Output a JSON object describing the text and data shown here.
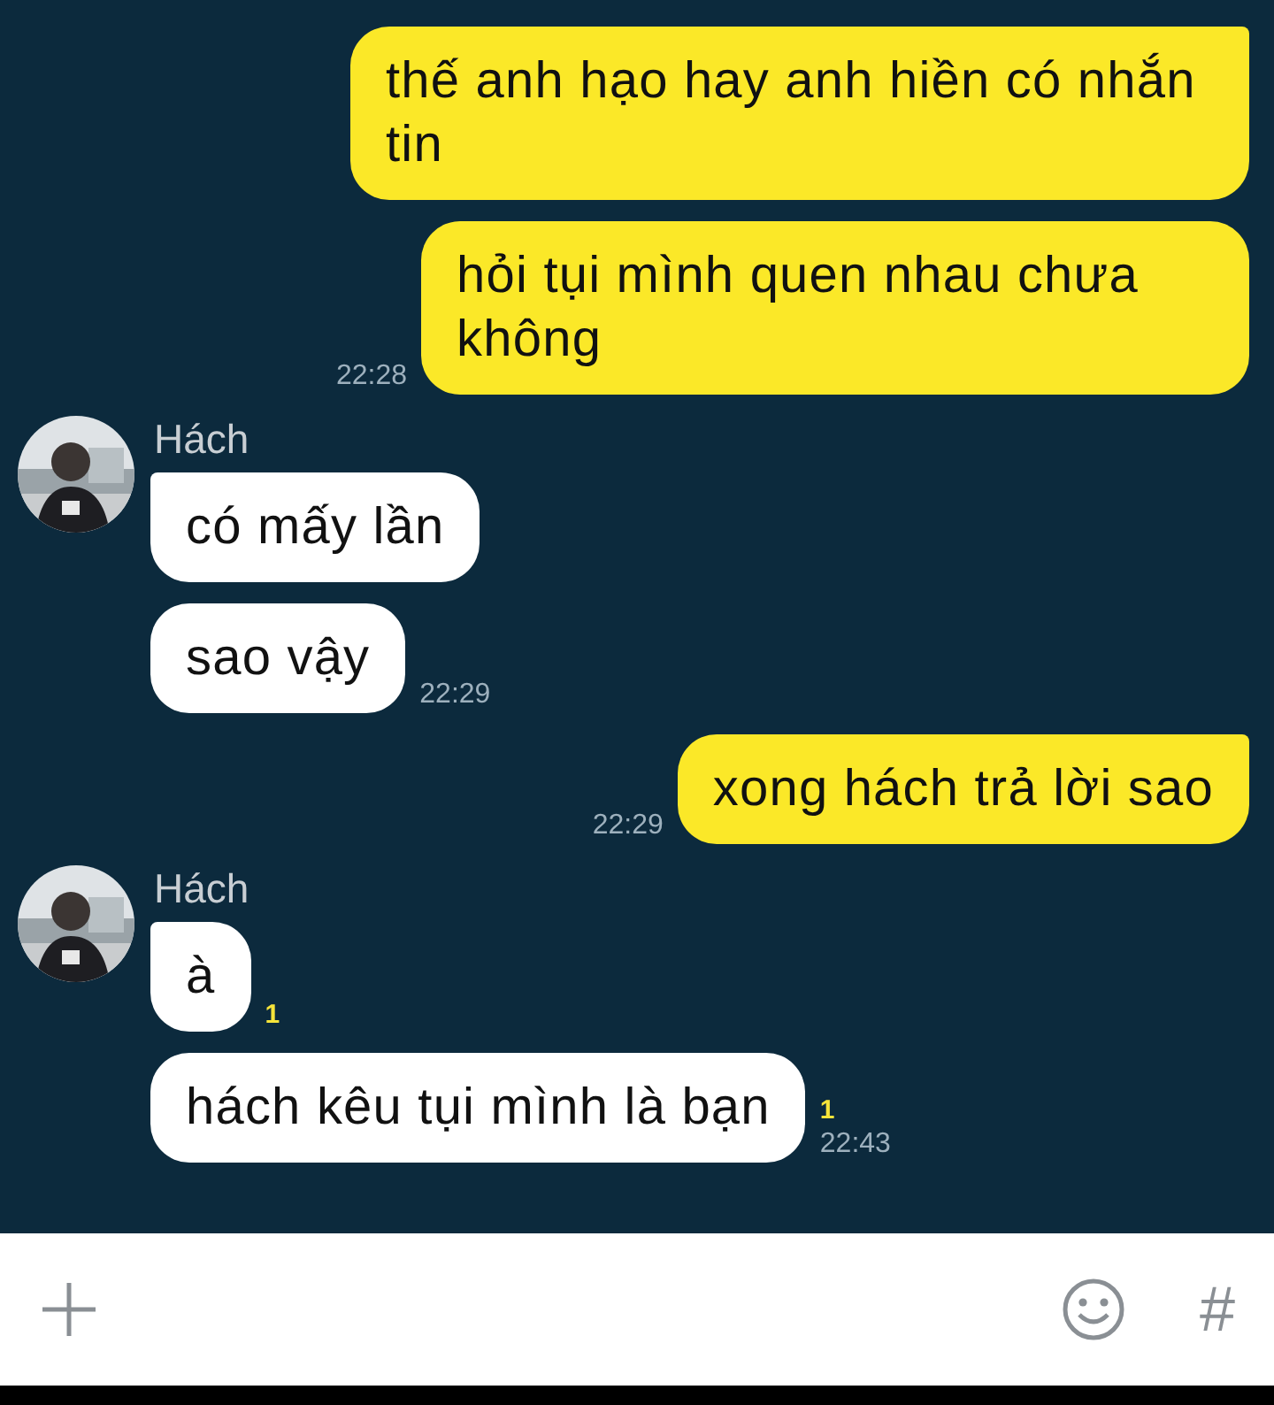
{
  "messages": [
    {
      "kind": "sent",
      "tail": true,
      "text": "thế anh hạo hay anh hiền có nhắn tin"
    },
    {
      "kind": "sent",
      "tail": false,
      "text": "hỏi tụi mình quen nhau chưa không",
      "time": "22:28"
    },
    {
      "kind": "received",
      "tail": true,
      "sender": "Hách",
      "text": "có mấy lần"
    },
    {
      "kind": "received",
      "tail": false,
      "text": "sao vậy",
      "time": "22:29"
    },
    {
      "kind": "sent",
      "tail": true,
      "text": "xong hách trả lời sao",
      "time": "22:29"
    },
    {
      "kind": "received",
      "tail": true,
      "sender": "Hách",
      "text": "à",
      "unread": "1"
    },
    {
      "kind": "received",
      "tail": false,
      "text": "hách kêu tụi mình là bạn",
      "unread": "1",
      "time": "22:43"
    }
  ],
  "composer": {
    "hashtag": "#"
  }
}
